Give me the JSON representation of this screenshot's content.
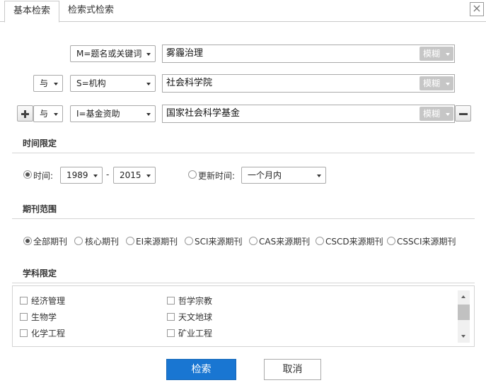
{
  "tabs": [
    {
      "label": "基本检索"
    },
    {
      "label": "检索式检索"
    }
  ],
  "close_label": "×",
  "rows": [
    {
      "logic": "",
      "field": "M=题名或关键词",
      "value": "雾霾治理",
      "match": "模糊"
    },
    {
      "logic": "与",
      "field": "S=机构",
      "value": "社会科学院",
      "match": "模糊"
    },
    {
      "logic": "与",
      "field": "I=基金资助",
      "value": "国家社会科学基金",
      "match": "模糊"
    }
  ],
  "time": {
    "title": "时间限定",
    "time_label": "时间:",
    "from_year": "1989",
    "dash": "-",
    "to_year": "2015",
    "update_label": "更新时间:",
    "update_value": "一个月内"
  },
  "journals": {
    "title": "期刊范围",
    "options": [
      "全部期刊",
      "核心期刊",
      "EI来源期刊",
      "SCI来源期刊",
      "CAS来源期刊",
      "CSCD来源期刊",
      "CSSCI来源期刊"
    ],
    "selected": "全部期刊"
  },
  "subjects": {
    "title": "学科限定",
    "left": [
      "经济管理",
      "生物学",
      "化学工程"
    ],
    "right": [
      "哲学宗教",
      "天文地球",
      "矿业工程"
    ]
  },
  "buttons": {
    "search": "检索",
    "cancel": "取消"
  },
  "colors": {
    "primary": "#1976d2",
    "border": "#aaaaaa",
    "fuzzy_bg": "#c6c6c6"
  }
}
